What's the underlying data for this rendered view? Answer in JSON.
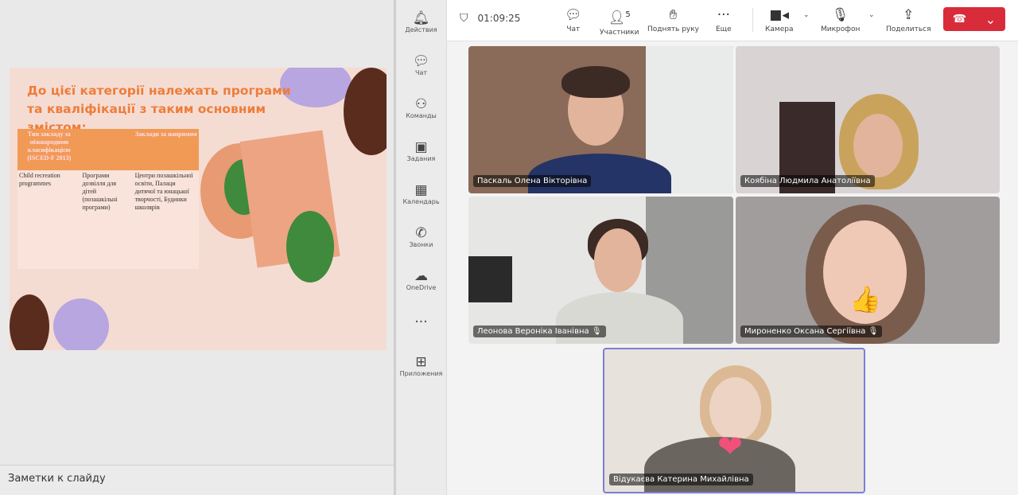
{
  "slide": {
    "title": "До цієї категорії належать програми та кваліфікації з таким основним змістом:",
    "table": {
      "headers": [
        "Тип закладу за міжнародною класифікацією (ISCED-F 2013)",
        "",
        "Заклади за напрямом"
      ],
      "rows": [
        [
          "Child recreation programmes",
          "Програми дозвілля для дітей (позашкільні програми)",
          "Центри позашкільної освіти, Палаци дитячої та юнацької творчості, Будинки школярів"
        ]
      ]
    }
  },
  "notes": {
    "label": "Заметки к слайду"
  },
  "rail": {
    "items": [
      {
        "label": "Действия",
        "icon": "bell-icon"
      },
      {
        "label": "Чат",
        "icon": "chat-icon"
      },
      {
        "label": "Команды",
        "icon": "teams-icon"
      },
      {
        "label": "Задания",
        "icon": "assignments-icon"
      },
      {
        "label": "Календарь",
        "icon": "calendar-icon"
      },
      {
        "label": "Звонки",
        "icon": "phone-icon"
      },
      {
        "label": "OneDrive",
        "icon": "cloud-icon"
      },
      {
        "label": "",
        "icon": "more-icon"
      },
      {
        "label": "Приложения",
        "icon": "apps-icon"
      }
    ]
  },
  "toolbar": {
    "timer": "01:09:25",
    "chat": "Чат",
    "participants": "Участники",
    "participants_count": "5",
    "raise_hand": "Поднять руку",
    "more": "Еще",
    "camera": "Камера",
    "mic": "Микрофон",
    "share": "Поделиться",
    "end_color": "#d92c3a"
  },
  "participants": [
    {
      "name": "Паскаль Олена Вікторівна",
      "muted": false
    },
    {
      "name": "Коябіна Людмила Анатоліївна",
      "muted": false
    },
    {
      "name": "Леонова Вероніка Іванівна",
      "muted": true
    },
    {
      "name": "Мироненко Оксана Сергіївна",
      "muted": true,
      "reaction": "👍"
    },
    {
      "name": "Відукаєва Катерина Михайлівна",
      "muted": false,
      "reaction": "❤",
      "active": true
    }
  ],
  "colors": {
    "accent": "#7b7fd4",
    "slide_title": "#ee7d3a"
  }
}
